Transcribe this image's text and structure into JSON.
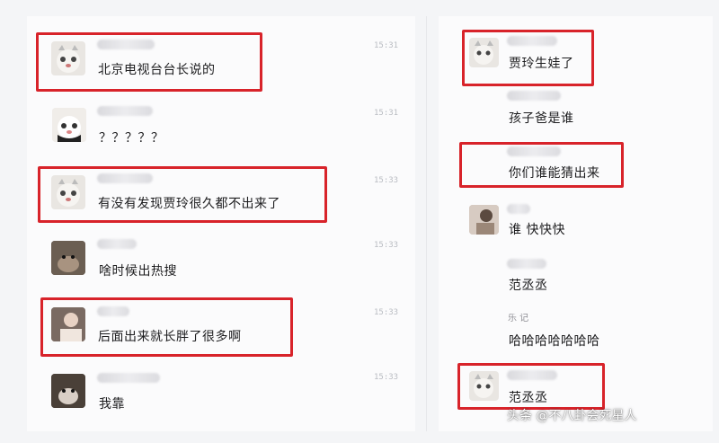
{
  "left_messages": [
    {
      "time": "15:31",
      "text": "北京电视台台长说的"
    },
    {
      "time": "15:31",
      "text": "？？？？？"
    },
    {
      "time": "15:33",
      "text": "有没有发现贾玲很久都不出来了"
    },
    {
      "time": "15:33",
      "text": "啥时候出热搜"
    },
    {
      "time": "15:33",
      "text": "后面出来就长胖了很多啊"
    },
    {
      "time": "15:33",
      "text": "我靠"
    }
  ],
  "right_messages": [
    {
      "text": "贾玲生娃了"
    },
    {
      "text": "孩子爸是谁"
    },
    {
      "text": "你们谁能猜出来"
    },
    {
      "text": "谁 快快快"
    },
    {
      "text": "范丞丞"
    },
    {
      "name": "乐 记",
      "text": "哈哈哈哈哈哈哈"
    },
    {
      "text": "范丞丞"
    }
  ],
  "watermark": "头条 @不八卦会死星人",
  "colors": {
    "highlight": "#d8232a",
    "background": "#f4f5f7"
  }
}
